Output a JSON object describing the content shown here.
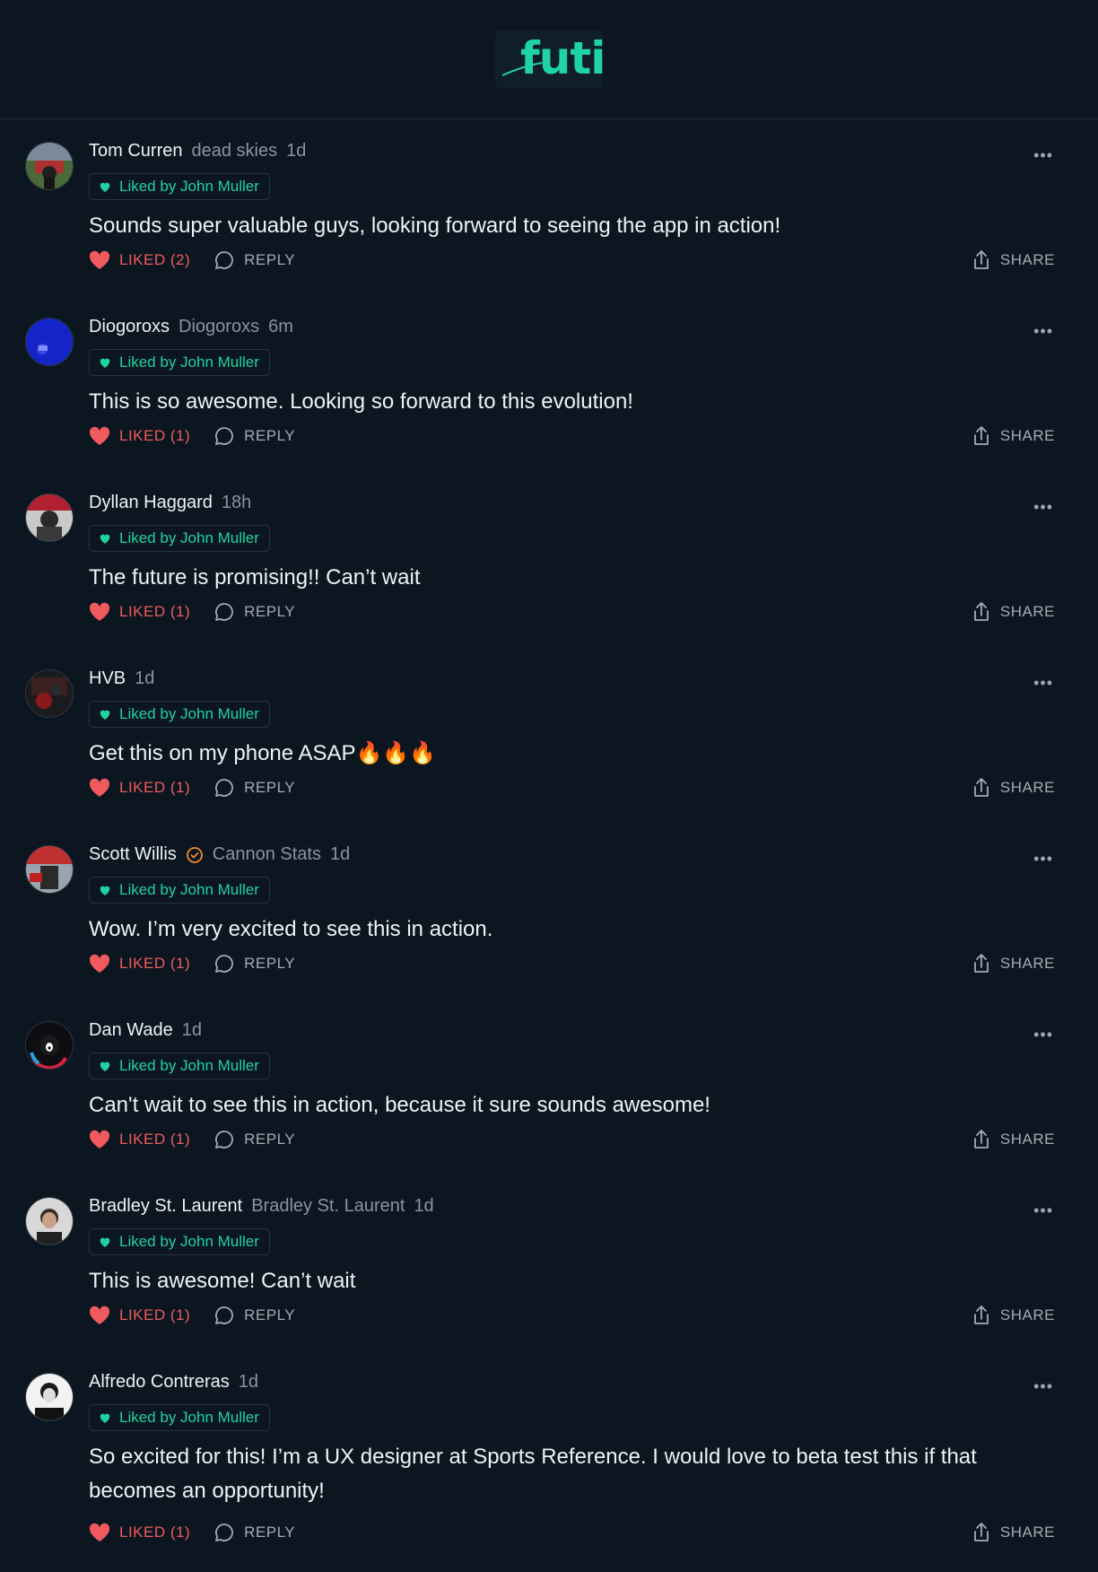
{
  "app": {
    "logo_text": "futi",
    "brand_color": "#20d3a4"
  },
  "labels": {
    "reply": "REPLY",
    "share": "SHARE",
    "more": "•••",
    "liked_prefix": "LIKED"
  },
  "comments": [
    {
      "name": "Tom Curren",
      "subtitle": "dead skies",
      "time": "1d",
      "liked_by": "Liked by John Muller",
      "text": "Sounds super valuable guys, looking forward to seeing the app in action!",
      "like_label": "LIKED (2)",
      "verified": false
    },
    {
      "name": "Diogoroxs",
      "subtitle": "Diogoroxs",
      "time": "6m",
      "liked_by": "Liked by John Muller",
      "text": "This is so awesome. Looking so forward to this evolution!",
      "like_label": "LIKED (1)",
      "verified": false
    },
    {
      "name": "Dyllan Haggard",
      "subtitle": "",
      "time": "18h",
      "liked_by": "Liked by John Muller",
      "text": "The future is promising!! Can’t wait",
      "like_label": "LIKED (1)",
      "verified": false
    },
    {
      "name": "HVB",
      "subtitle": "",
      "time": "1d",
      "liked_by": "Liked by John Muller",
      "text": "Get this on my phone ASAP🔥🔥🔥",
      "like_label": "LIKED (1)",
      "verified": false
    },
    {
      "name": "Scott Willis",
      "subtitle": "Cannon Stats",
      "time": "1d",
      "liked_by": "Liked by John Muller",
      "text": "Wow. I’m very excited to see this in action.",
      "like_label": "LIKED (1)",
      "verified": true
    },
    {
      "name": "Dan Wade",
      "subtitle": "",
      "time": "1d",
      "liked_by": "Liked by John Muller",
      "text": "Can't wait to see this in action, because it sure sounds awesome!",
      "like_label": "LIKED (1)",
      "verified": false
    },
    {
      "name": "Bradley St. Laurent",
      "subtitle": "Bradley St. Laurent",
      "time": "1d",
      "liked_by": "Liked by John Muller",
      "text": "This is awesome! Can’t wait",
      "like_label": "LIKED (1)",
      "verified": false
    },
    {
      "name": "Alfredo Contreras",
      "subtitle": "",
      "time": "1d",
      "liked_by": "Liked by John Muller",
      "text": "So excited for this! I’m a UX designer at Sports Reference. I would love to beta test this if that becomes an opportunity!",
      "like_label": "LIKED (1)",
      "verified": false
    }
  ]
}
